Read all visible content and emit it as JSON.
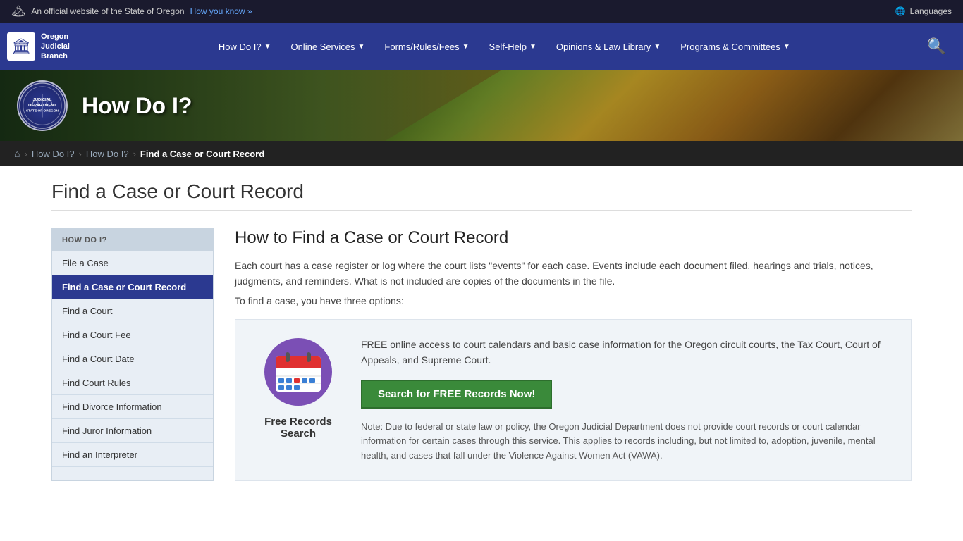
{
  "topbar": {
    "official_text": "An official website of the State of Oregon",
    "know_link": "How you know »",
    "languages_label": "Languages"
  },
  "nav": {
    "logo": {
      "icon": "🏛",
      "line1": "Oregon",
      "line2": "Judicial",
      "line3": "Branch"
    },
    "items": [
      {
        "label": "How Do I?",
        "id": "how-do-i"
      },
      {
        "label": "Online Services",
        "id": "online-services"
      },
      {
        "label": "Forms/Rules/Fees",
        "id": "forms-rules-fees"
      },
      {
        "label": "Self-Help",
        "id": "self-help"
      },
      {
        "label": "Opinions & Law Library",
        "id": "opinions-law-library"
      },
      {
        "label": "Programs & Committees",
        "id": "programs-committees"
      }
    ]
  },
  "hero": {
    "title": "How Do I?",
    "seal_text": "JUDICIAL\nDEPT"
  },
  "breadcrumb": {
    "home_icon": "⌂",
    "items": [
      {
        "label": "How Do I?",
        "href": "#"
      },
      {
        "label": "How Do I?",
        "href": "#"
      },
      {
        "label": "Find a Case or Court Record",
        "current": true
      }
    ]
  },
  "page": {
    "title": "Find a Case or Court Record"
  },
  "sidebar": {
    "heading": "HOW DO I?",
    "items": [
      {
        "label": "File a Case",
        "active": false
      },
      {
        "label": "Find a Case or Court Record",
        "active": true
      },
      {
        "label": "Find a Court",
        "active": false
      },
      {
        "label": "Find a Court Fee",
        "active": false
      },
      {
        "label": "Find a Court Date",
        "active": false
      },
      {
        "label": "Find Court Rules",
        "active": false
      },
      {
        "label": "Find Divorce Information",
        "active": false
      },
      {
        "label": "Find Juror Information",
        "active": false
      },
      {
        "label": "Find an Interpreter",
        "active": false
      }
    ]
  },
  "article": {
    "title": "How to Find a Case or Court Record",
    "intro": "Each court has a case register or log where the court lists \"events\" for each case. Events include each document filed, hearings and trials, notices, judgments, and reminders. What is not included are copies of the documents in the file.",
    "options_text": "To find a case, you have three options:",
    "records_card": {
      "description": "FREE online access to court calendars and basic case information for the Oregon circuit courts, the Tax Court, Court of Appeals, and Supreme Court.",
      "button_label": "Search for FREE Records Now!",
      "icon_label": "Free Records\nSearch",
      "note": "Note: Due to federal or state law or policy, the Oregon Judicial Department does not provide court records or court calendar information for certain cases through this service. This applies to records including, but not limited to, adoption, juvenile, mental health, and cases that fall under the Violence Against Women Act (VAWA)."
    }
  }
}
